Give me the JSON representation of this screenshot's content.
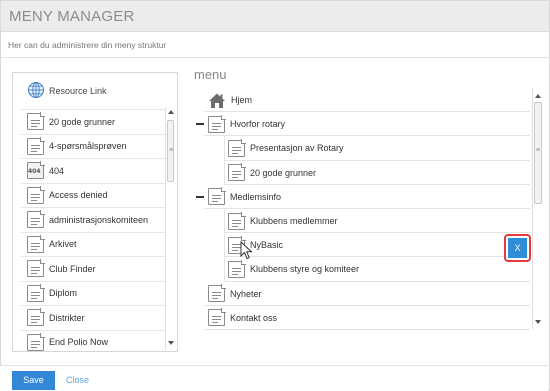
{
  "dialog": {
    "title": "MENY MANAGER",
    "subtitle": "Her can du administrere din meny struktur"
  },
  "resource_link": {
    "label": "Resource Link",
    "icon": "globe-icon"
  },
  "pages": [
    {
      "label": "20 gode grunner",
      "icon": "document-icon"
    },
    {
      "label": "4-spørsmålsprøven",
      "icon": "document-icon"
    },
    {
      "label": "404",
      "icon": "document-404-icon"
    },
    {
      "label": "Access denied",
      "icon": "document-icon"
    },
    {
      "label": "administrasjonskomiteen",
      "icon": "document-icon"
    },
    {
      "label": "Arkivet",
      "icon": "document-icon"
    },
    {
      "label": "Club Finder",
      "icon": "document-icon"
    },
    {
      "label": "Diplom",
      "icon": "document-icon"
    },
    {
      "label": "Distrikter",
      "icon": "document-icon"
    },
    {
      "label": "End Polio Now",
      "icon": "document-icon"
    }
  ],
  "menu": {
    "title": "menu",
    "items": [
      {
        "label": "Hjem",
        "level": 0,
        "icon": "home-icon",
        "expanded": null
      },
      {
        "label": "Hvorfor rotary",
        "level": 0,
        "icon": "document-icon",
        "expanded": true
      },
      {
        "label": "Presentasjon av Rotary",
        "level": 1,
        "icon": "document-icon",
        "expanded": null
      },
      {
        "label": "20 gode grunner",
        "level": 1,
        "icon": "document-icon",
        "expanded": null
      },
      {
        "label": "Medlemsinfo",
        "level": 0,
        "icon": "document-icon",
        "expanded": true
      },
      {
        "label": "Klubbens medlemmer",
        "level": 1,
        "icon": "document-icon",
        "expanded": null
      },
      {
        "label": "NyBasic",
        "level": 1,
        "icon": "document-icon",
        "expanded": null
      },
      {
        "label": "Klubbens styre og komiteer",
        "level": 1,
        "icon": "document-icon",
        "expanded": null
      },
      {
        "label": "Nyheter",
        "level": 0,
        "icon": "document-icon",
        "expanded": null
      },
      {
        "label": "Kontakt oss",
        "level": 0,
        "icon": "document-icon",
        "expanded": null
      }
    ],
    "remove_button_label": "X"
  },
  "footer": {
    "save_label": "Save",
    "close_label": "Close"
  },
  "colors": {
    "accent": "#3388d6",
    "highlight": "#e23b3b",
    "header_bg": "#ececec"
  }
}
